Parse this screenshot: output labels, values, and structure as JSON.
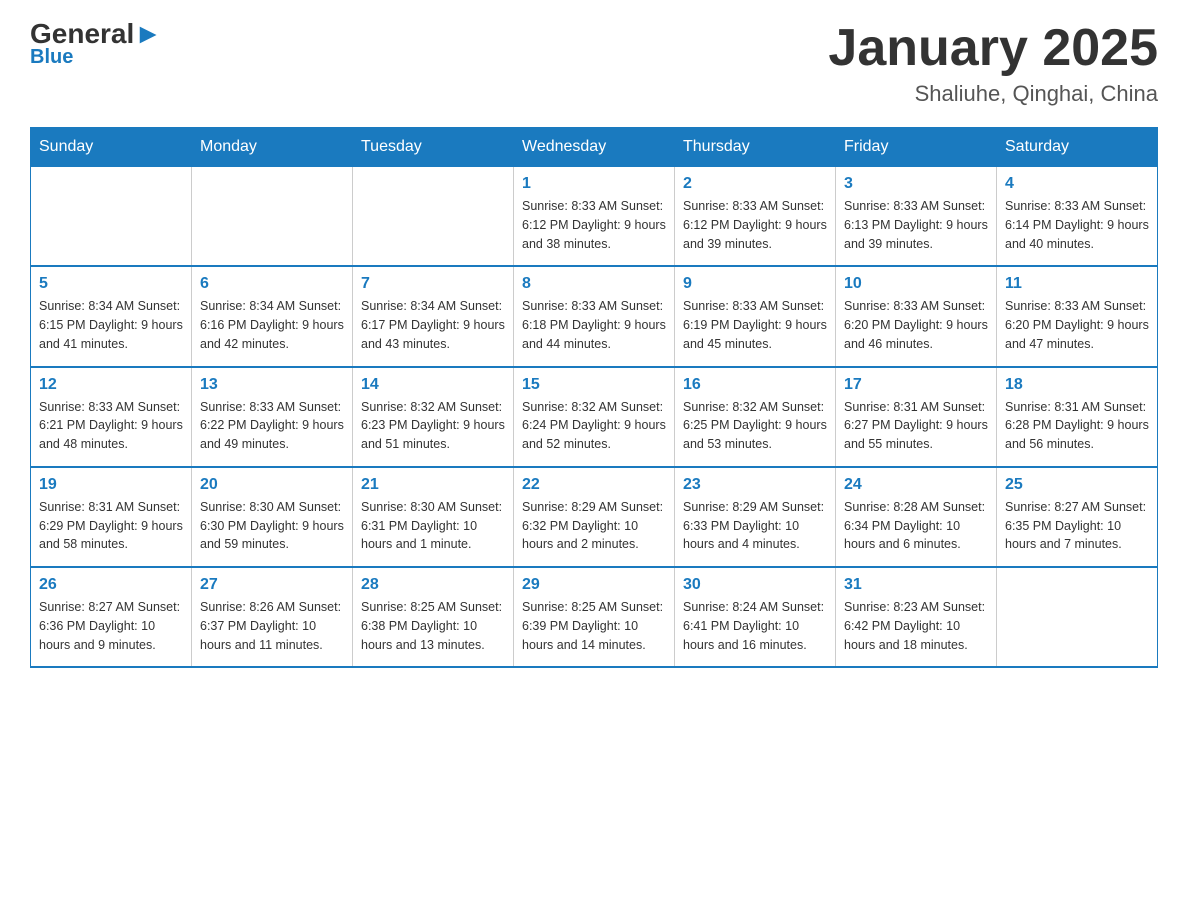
{
  "logo": {
    "general": "General",
    "arrow": "▶",
    "blue": "Blue"
  },
  "title": "January 2025",
  "subtitle": "Shaliuhe, Qinghai, China",
  "headers": [
    "Sunday",
    "Monday",
    "Tuesday",
    "Wednesday",
    "Thursday",
    "Friday",
    "Saturday"
  ],
  "weeks": [
    [
      {
        "day": "",
        "info": ""
      },
      {
        "day": "",
        "info": ""
      },
      {
        "day": "",
        "info": ""
      },
      {
        "day": "1",
        "info": "Sunrise: 8:33 AM\nSunset: 6:12 PM\nDaylight: 9 hours\nand 38 minutes."
      },
      {
        "day": "2",
        "info": "Sunrise: 8:33 AM\nSunset: 6:12 PM\nDaylight: 9 hours\nand 39 minutes."
      },
      {
        "day": "3",
        "info": "Sunrise: 8:33 AM\nSunset: 6:13 PM\nDaylight: 9 hours\nand 39 minutes."
      },
      {
        "day": "4",
        "info": "Sunrise: 8:33 AM\nSunset: 6:14 PM\nDaylight: 9 hours\nand 40 minutes."
      }
    ],
    [
      {
        "day": "5",
        "info": "Sunrise: 8:34 AM\nSunset: 6:15 PM\nDaylight: 9 hours\nand 41 minutes."
      },
      {
        "day": "6",
        "info": "Sunrise: 8:34 AM\nSunset: 6:16 PM\nDaylight: 9 hours\nand 42 minutes."
      },
      {
        "day": "7",
        "info": "Sunrise: 8:34 AM\nSunset: 6:17 PM\nDaylight: 9 hours\nand 43 minutes."
      },
      {
        "day": "8",
        "info": "Sunrise: 8:33 AM\nSunset: 6:18 PM\nDaylight: 9 hours\nand 44 minutes."
      },
      {
        "day": "9",
        "info": "Sunrise: 8:33 AM\nSunset: 6:19 PM\nDaylight: 9 hours\nand 45 minutes."
      },
      {
        "day": "10",
        "info": "Sunrise: 8:33 AM\nSunset: 6:20 PM\nDaylight: 9 hours\nand 46 minutes."
      },
      {
        "day": "11",
        "info": "Sunrise: 8:33 AM\nSunset: 6:20 PM\nDaylight: 9 hours\nand 47 minutes."
      }
    ],
    [
      {
        "day": "12",
        "info": "Sunrise: 8:33 AM\nSunset: 6:21 PM\nDaylight: 9 hours\nand 48 minutes."
      },
      {
        "day": "13",
        "info": "Sunrise: 8:33 AM\nSunset: 6:22 PM\nDaylight: 9 hours\nand 49 minutes."
      },
      {
        "day": "14",
        "info": "Sunrise: 8:32 AM\nSunset: 6:23 PM\nDaylight: 9 hours\nand 51 minutes."
      },
      {
        "day": "15",
        "info": "Sunrise: 8:32 AM\nSunset: 6:24 PM\nDaylight: 9 hours\nand 52 minutes."
      },
      {
        "day": "16",
        "info": "Sunrise: 8:32 AM\nSunset: 6:25 PM\nDaylight: 9 hours\nand 53 minutes."
      },
      {
        "day": "17",
        "info": "Sunrise: 8:31 AM\nSunset: 6:27 PM\nDaylight: 9 hours\nand 55 minutes."
      },
      {
        "day": "18",
        "info": "Sunrise: 8:31 AM\nSunset: 6:28 PM\nDaylight: 9 hours\nand 56 minutes."
      }
    ],
    [
      {
        "day": "19",
        "info": "Sunrise: 8:31 AM\nSunset: 6:29 PM\nDaylight: 9 hours\nand 58 minutes."
      },
      {
        "day": "20",
        "info": "Sunrise: 8:30 AM\nSunset: 6:30 PM\nDaylight: 9 hours\nand 59 minutes."
      },
      {
        "day": "21",
        "info": "Sunrise: 8:30 AM\nSunset: 6:31 PM\nDaylight: 10 hours\nand 1 minute."
      },
      {
        "day": "22",
        "info": "Sunrise: 8:29 AM\nSunset: 6:32 PM\nDaylight: 10 hours\nand 2 minutes."
      },
      {
        "day": "23",
        "info": "Sunrise: 8:29 AM\nSunset: 6:33 PM\nDaylight: 10 hours\nand 4 minutes."
      },
      {
        "day": "24",
        "info": "Sunrise: 8:28 AM\nSunset: 6:34 PM\nDaylight: 10 hours\nand 6 minutes."
      },
      {
        "day": "25",
        "info": "Sunrise: 8:27 AM\nSunset: 6:35 PM\nDaylight: 10 hours\nand 7 minutes."
      }
    ],
    [
      {
        "day": "26",
        "info": "Sunrise: 8:27 AM\nSunset: 6:36 PM\nDaylight: 10 hours\nand 9 minutes."
      },
      {
        "day": "27",
        "info": "Sunrise: 8:26 AM\nSunset: 6:37 PM\nDaylight: 10 hours\nand 11 minutes."
      },
      {
        "day": "28",
        "info": "Sunrise: 8:25 AM\nSunset: 6:38 PM\nDaylight: 10 hours\nand 13 minutes."
      },
      {
        "day": "29",
        "info": "Sunrise: 8:25 AM\nSunset: 6:39 PM\nDaylight: 10 hours\nand 14 minutes."
      },
      {
        "day": "30",
        "info": "Sunrise: 8:24 AM\nSunset: 6:41 PM\nDaylight: 10 hours\nand 16 minutes."
      },
      {
        "day": "31",
        "info": "Sunrise: 8:23 AM\nSunset: 6:42 PM\nDaylight: 10 hours\nand 18 minutes."
      },
      {
        "day": "",
        "info": ""
      }
    ]
  ]
}
